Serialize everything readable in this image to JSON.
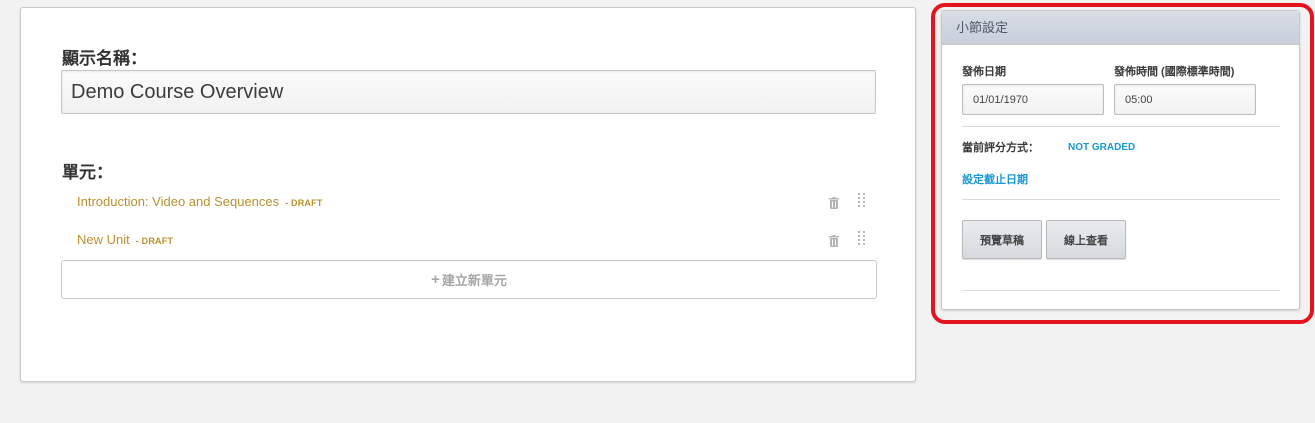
{
  "editor": {
    "display_name_label": "顯示名稱：",
    "display_name_value": "Demo Course Overview",
    "units_label": "單元：",
    "units": [
      {
        "title": "Introduction: Video and Sequences",
        "status": "- DRAFT"
      },
      {
        "title": "New Unit",
        "status": "- DRAFT"
      }
    ],
    "add_unit_icon": "+",
    "add_unit_label": "建立新單元"
  },
  "settings": {
    "header": "小節設定",
    "release_date_label": "發佈日期",
    "release_date_value": "01/01/1970",
    "release_time_label": "發佈時間 (國際標準時間)",
    "release_time_value": "05:00",
    "grading_label": "當前評分方式：",
    "grading_value": "NOT GRADED",
    "set_due_date_label": "設定截止日期",
    "preview_button": "預覽草稿",
    "view_live_button": "線上查看"
  },
  "colors": {
    "unit_link": "#b9912f",
    "accent_link": "#1a98d5",
    "highlight": "#e3141b"
  }
}
